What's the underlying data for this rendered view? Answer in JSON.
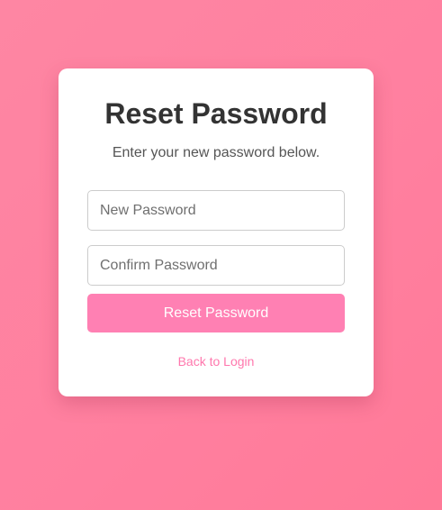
{
  "page": {
    "background_color": "#ff809f"
  },
  "card": {
    "title": "Reset Password",
    "subtitle": "Enter your new password below.",
    "new_password": {
      "value": "",
      "placeholder": "New Password"
    },
    "confirm_password": {
      "value": "",
      "placeholder": "Confirm Password"
    },
    "submit_label": "Reset Password",
    "back_link_label": "Back to Login"
  },
  "colors": {
    "accent": "#ff80b3",
    "link": "#ff77ad",
    "title_text": "#333333"
  }
}
